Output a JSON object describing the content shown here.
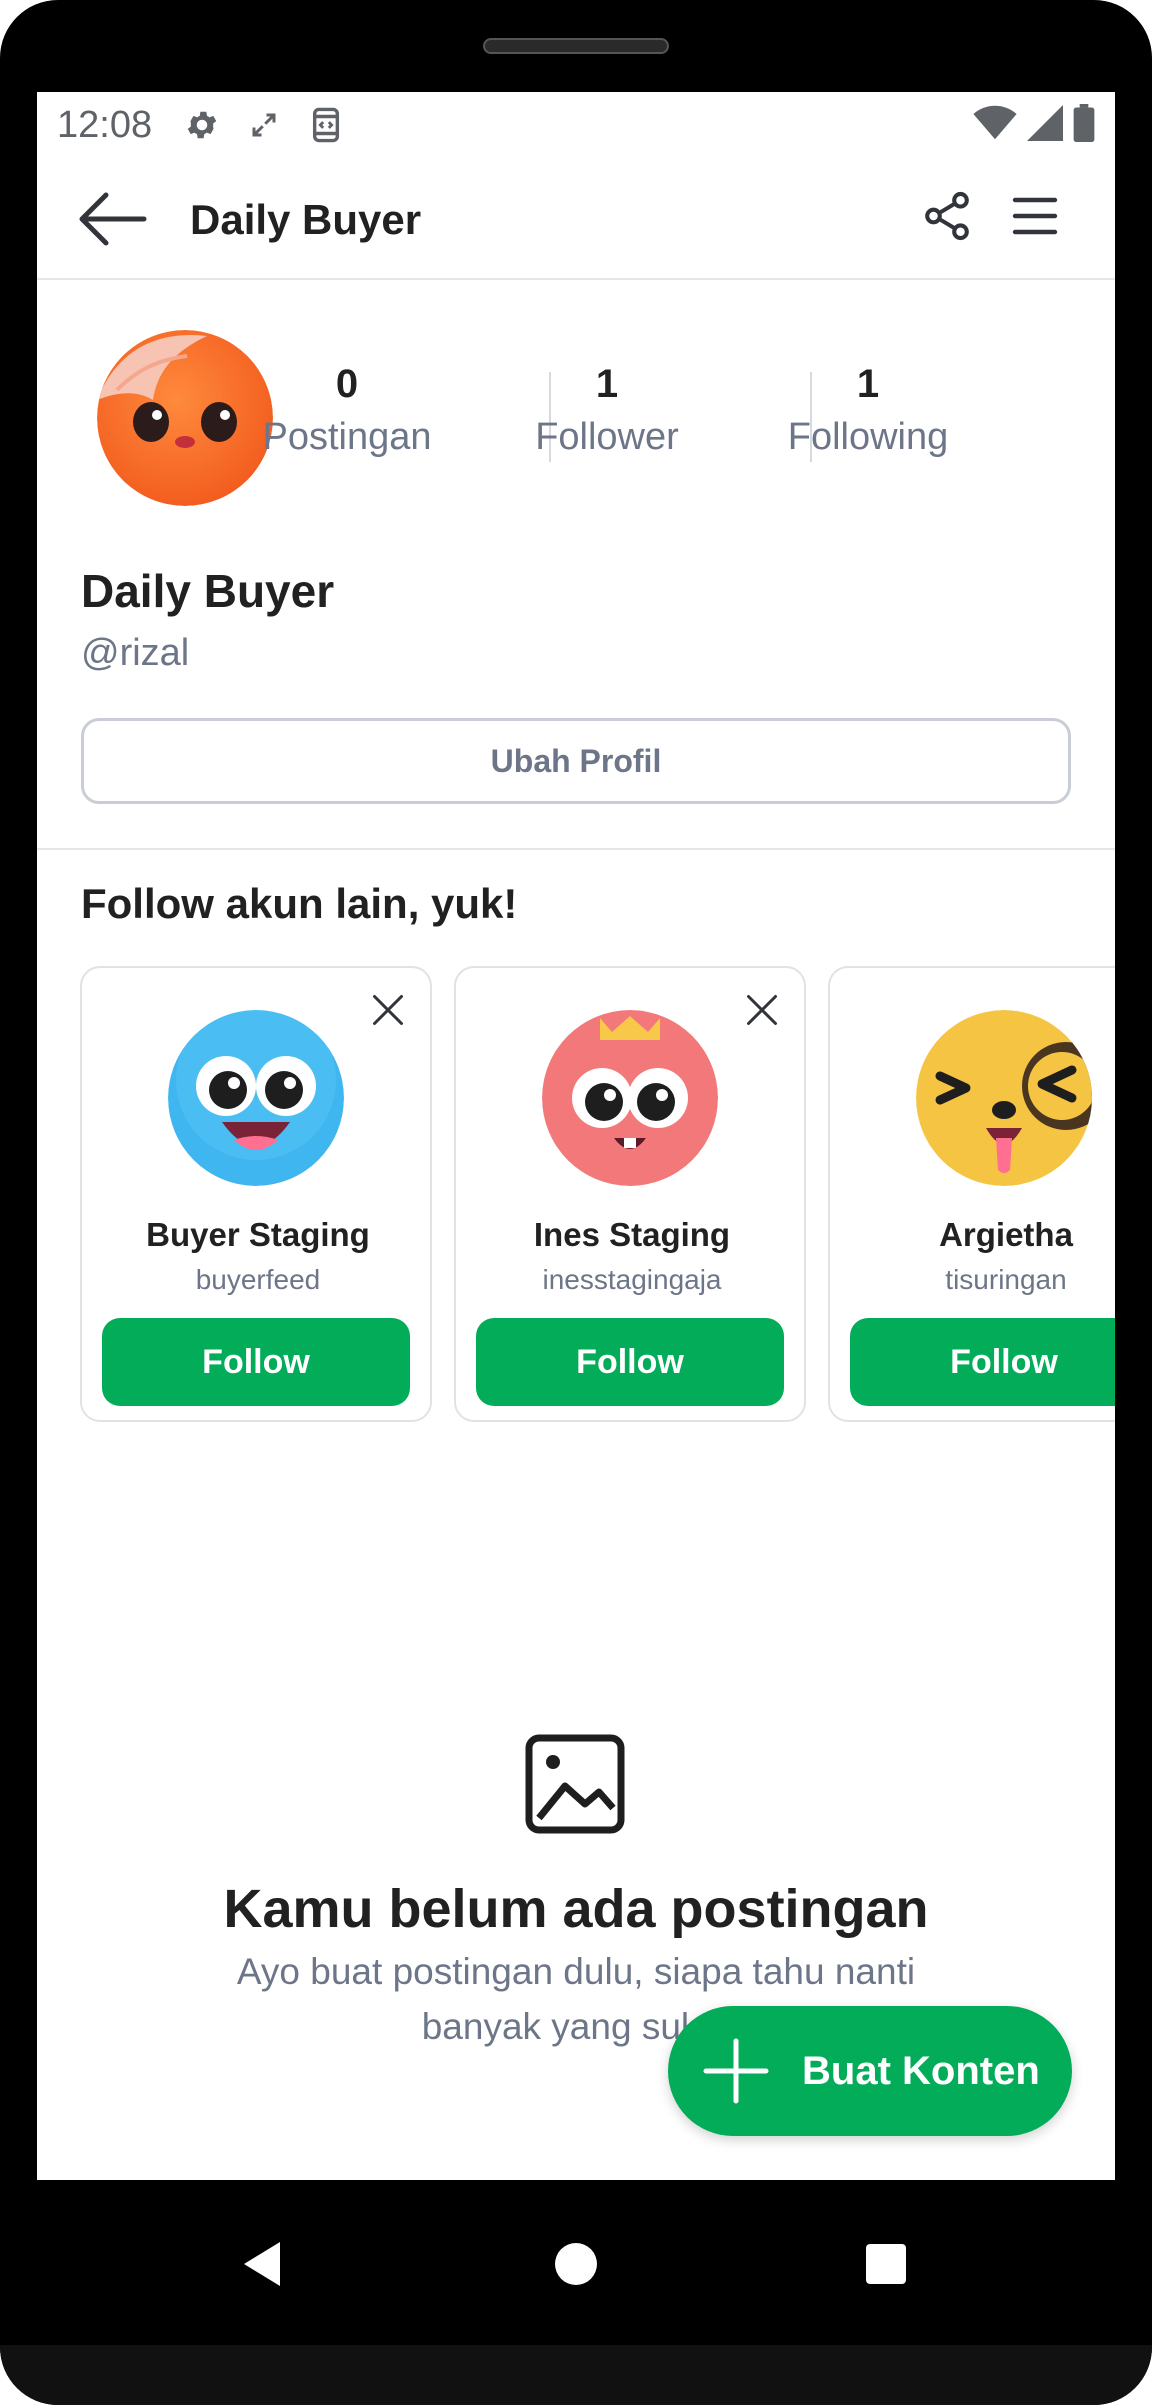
{
  "status_bar": {
    "time": "12:08",
    "icons_left": [
      "settings-icon",
      "expand-icon",
      "screenshot-icon"
    ],
    "icons_right": [
      "wifi-icon",
      "signal-icon",
      "battery-icon"
    ]
  },
  "app_bar": {
    "title": "Daily Buyer",
    "icons": [
      "back-arrow-icon",
      "share-icon",
      "menu-icon"
    ]
  },
  "profile": {
    "name": "Daily Buyer",
    "handle": "@rizal",
    "stats": [
      {
        "value": "0",
        "label": "Postingan"
      },
      {
        "value": "1",
        "label": "Follower"
      },
      {
        "value": "1",
        "label": "Following"
      }
    ],
    "edit_button": "Ubah Profil"
  },
  "suggestions": {
    "title": "Follow akun lain, yuk!",
    "cards": [
      {
        "name": "Buyer Staging",
        "username": "buyerfeed",
        "button": "Follow",
        "avatar_color": "#3fb6f0",
        "closable": true
      },
      {
        "name": "Ines Staging",
        "username": "inesstagingaja",
        "button": "Follow",
        "avatar_color": "#f2787a",
        "closable": true
      },
      {
        "name": "Argietha",
        "username": "tisuringan",
        "button": "Follow",
        "avatar_color": "#f6c443",
        "closable": false
      }
    ]
  },
  "empty_state": {
    "icon": "image-placeholder-icon",
    "title": "Kamu belum ada postingan",
    "description": "Ayo buat postingan dulu, siapa tahu nanti banyak yang suka."
  },
  "fab": {
    "label": "Buat Konten",
    "icon": "plus-icon"
  },
  "nav_bar": {
    "icons": [
      "nav-back-icon",
      "nav-home-icon",
      "nav-recents-icon"
    ]
  },
  "colors": {
    "primary_green": "#03ac59",
    "text_dark": "#212121",
    "text_muted": "#6d7588",
    "border": "#dfe2e6"
  }
}
